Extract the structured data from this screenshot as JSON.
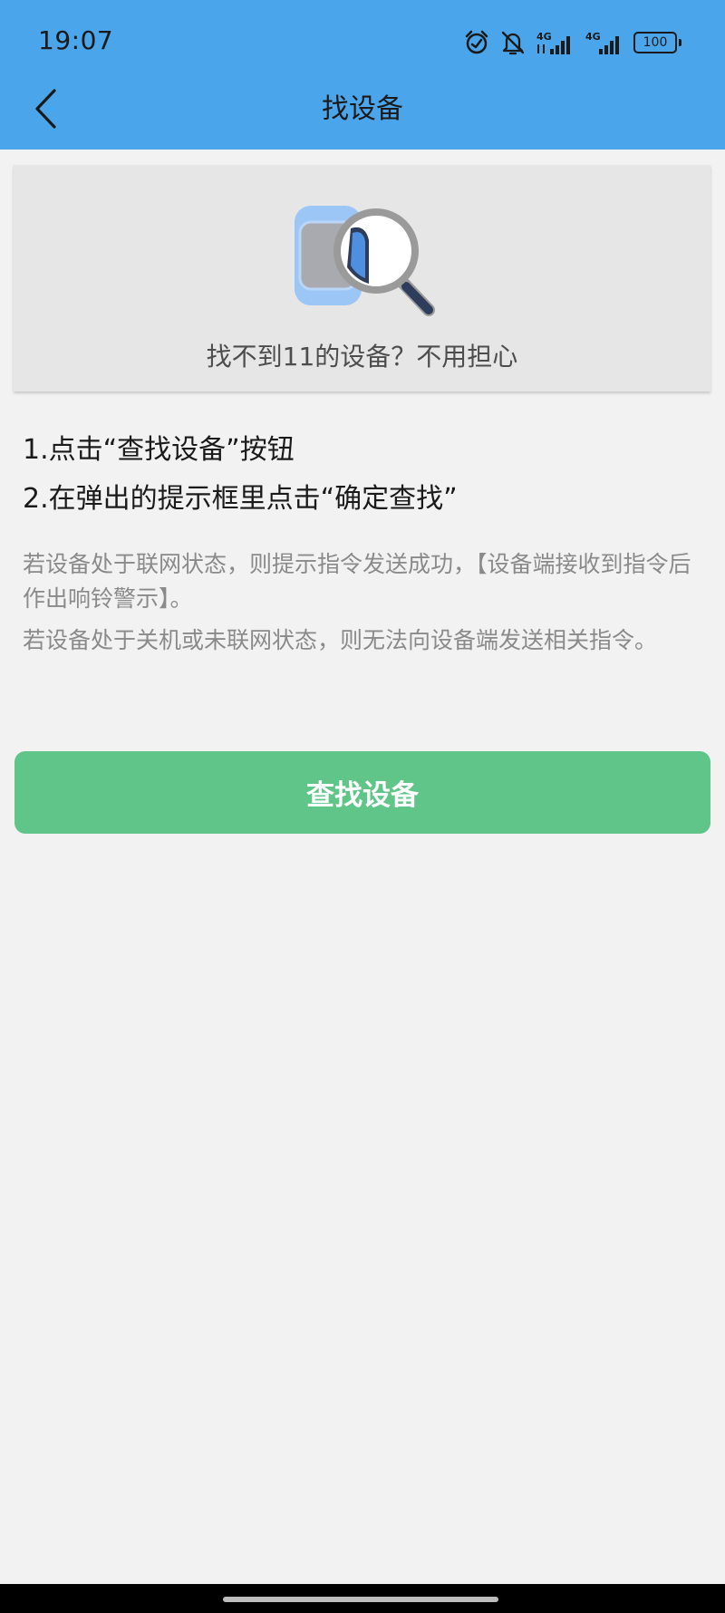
{
  "status_bar": {
    "time": "19:07",
    "signal1_label": "4G",
    "signal2_label": "4G",
    "battery": "100",
    "icons": [
      "alarm-icon",
      "bell-off-icon",
      "signal-icon",
      "signal-icon",
      "battery-icon"
    ]
  },
  "header": {
    "title": "找设备",
    "back_icon": "chevron-left-icon",
    "background": "#4ba5ea"
  },
  "hero": {
    "text": "找不到11的设备？不用担心",
    "illustration": "watch-magnifier-icon"
  },
  "steps": [
    "1.点击“查找设备”按钮",
    "2.在弹出的提示框里点击“确定查找”"
  ],
  "notes": [
    "若设备处于联网状态，则提示指令发送成功，【设备端接收到指令后作出响铃警示】。",
    "若设备处于关机或未联网状态，则无法向设备端发送相关指令。"
  ],
  "actions": {
    "find_button_label": "查找设备",
    "find_button_color": "#60c588"
  }
}
